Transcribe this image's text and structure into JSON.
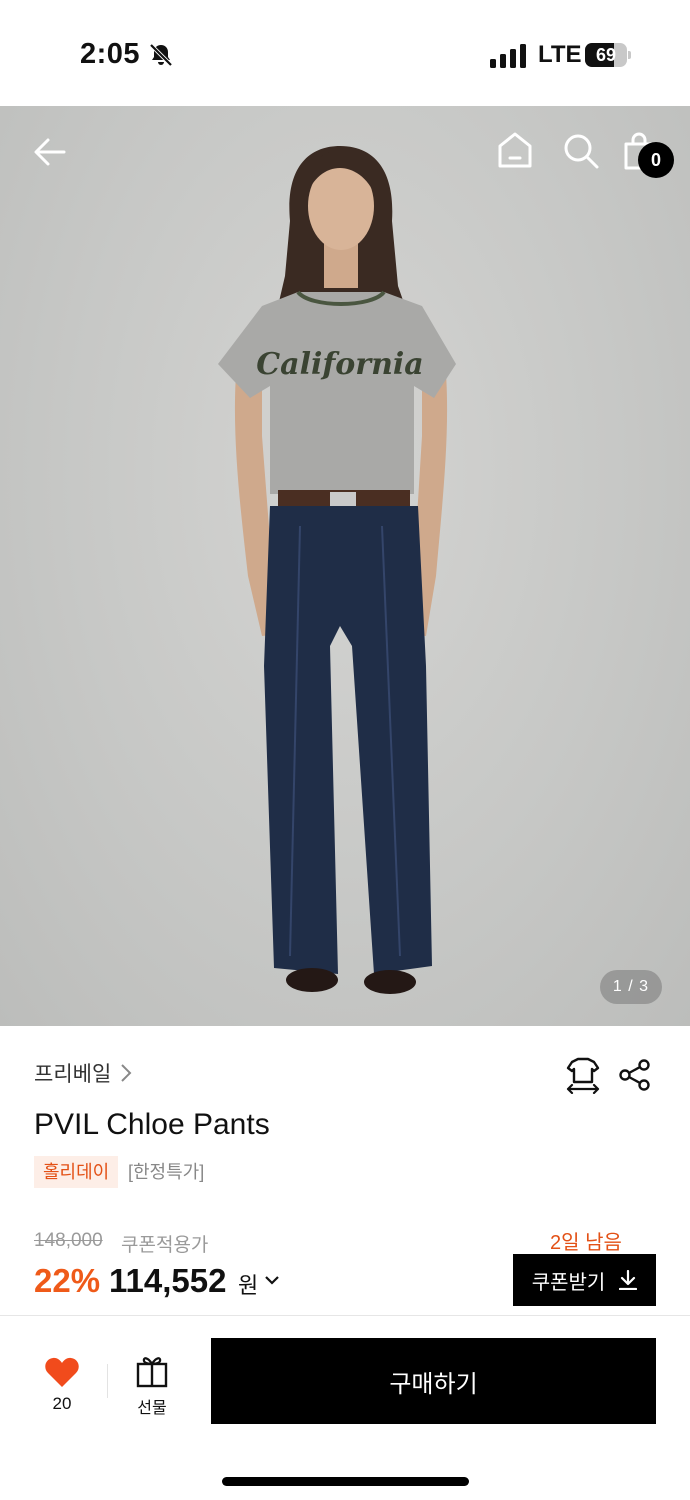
{
  "status_bar": {
    "time": "2:05",
    "network": "LTE",
    "battery_level": 69,
    "battery_text": "69"
  },
  "top_nav": {
    "cart_count": "0"
  },
  "gallery": {
    "counter": "1 / 3",
    "current_image": 1,
    "total_images": 3
  },
  "product": {
    "brand": "프리베일",
    "name": "PVIL Chloe Pants",
    "tags": {
      "holiday": "홀리데이",
      "limited": "[한정특가]"
    },
    "original_price": "148,000",
    "coupon_applied_label": "쿠폰적용가",
    "discount_percent": "22%",
    "sale_price": "114,552",
    "currency_unit": "원",
    "days_left": "2일 남음",
    "coupon_button": "쿠폰받기"
  },
  "bottom_bar": {
    "like_count": "20",
    "gift_label": "선물",
    "buy_label": "구매하기"
  },
  "colors": {
    "accent_orange": "#ef5a19",
    "tag_bg": "#fdeee7",
    "black": "#000000",
    "heart_red": "#f14b1c"
  }
}
